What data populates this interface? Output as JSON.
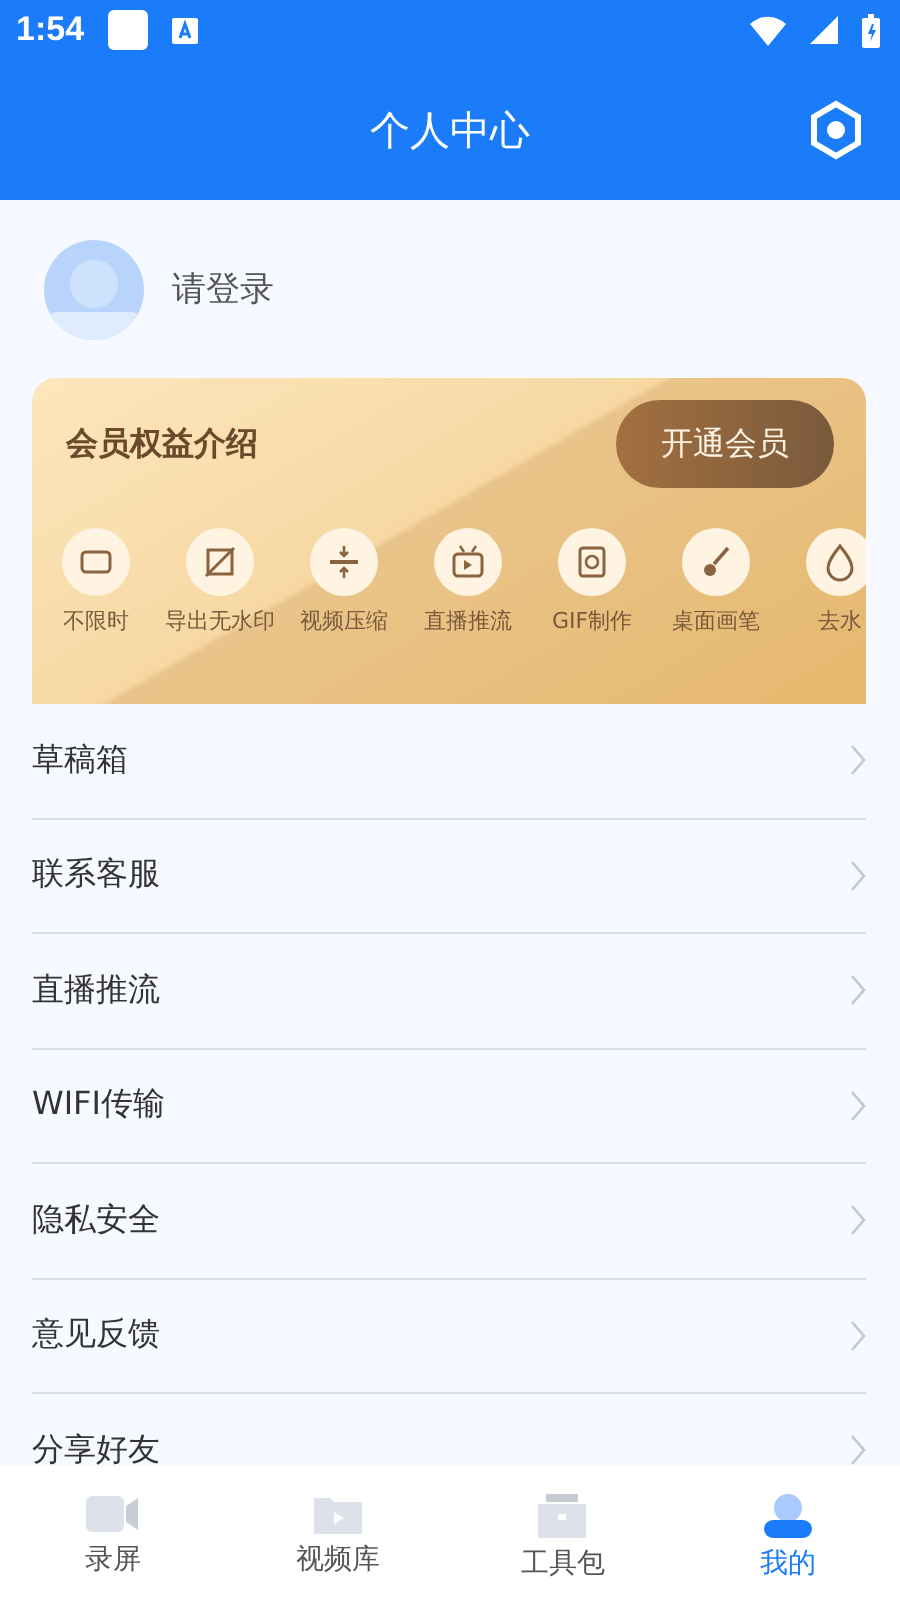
{
  "status_bar": {
    "time": "1:54"
  },
  "header": {
    "title": "个人中心"
  },
  "profile": {
    "login_label": "请登录"
  },
  "vip_card": {
    "title": "会员权益介绍",
    "button": "开通会员",
    "perks": [
      {
        "kind": "unlimited",
        "label": "不限时"
      },
      {
        "kind": "nowatermark",
        "label": "导出无水印"
      },
      {
        "kind": "compress",
        "label": "视频压缩"
      },
      {
        "kind": "live",
        "label": "直播推流"
      },
      {
        "kind": "gif",
        "label": "GIF制作"
      },
      {
        "kind": "brush",
        "label": "桌面画笔"
      },
      {
        "kind": "drop",
        "label": "去水"
      }
    ]
  },
  "menu": [
    "草稿箱",
    "联系客服",
    "直播推流",
    "WIFI传输",
    "隐私安全",
    "意见反馈",
    "分享好友"
  ],
  "tabs": [
    {
      "kind": "record",
      "label": "录屏",
      "selected": false
    },
    {
      "kind": "library",
      "label": "视频库",
      "selected": false
    },
    {
      "kind": "tools",
      "label": "工具包",
      "selected": false
    },
    {
      "kind": "me",
      "label": "我的",
      "selected": true
    }
  ]
}
